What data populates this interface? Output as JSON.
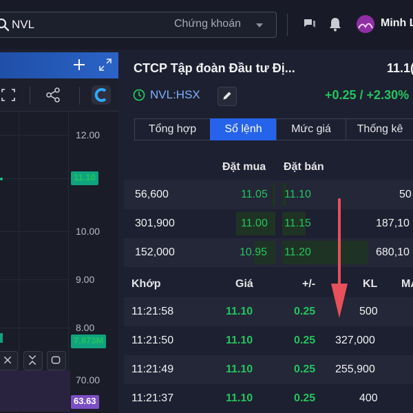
{
  "search": {
    "value": "NVL",
    "market": "Chứng khoán"
  },
  "user": {
    "name": "Minh L"
  },
  "chart": {
    "axis_labels": [
      "12.00",
      "10.00",
      "9.00",
      "8.00",
      "70.00"
    ],
    "price_tags": [
      "11.10",
      "7.873M",
      "63.63"
    ]
  },
  "stock": {
    "company": "CTCP Tập đoàn Đầu tư Đị...",
    "price": "11.1(",
    "ticker": "NVL:HSX",
    "change": "+0.25 / +2.30%",
    "tabs": [
      "Tổng hợp",
      "Sổ lệnh",
      "Mức giá",
      "Thống kê"
    ]
  },
  "order_book": {
    "headers": {
      "bid": "Đặt mua",
      "ask": "Đặt bán"
    },
    "rows": [
      {
        "bid_vol": "56,600",
        "bid_price": "11.05",
        "ask_price": "11.10",
        "ask_vol": "50"
      },
      {
        "bid_vol": "301,900",
        "bid_price": "11.00",
        "ask_price": "11.15",
        "ask_vol": "187,10"
      },
      {
        "bid_vol": "152,000",
        "bid_price": "10.95",
        "ask_price": "11.20",
        "ask_vol": "680,10"
      }
    ]
  },
  "matches": {
    "headers": {
      "time": "Khớp",
      "price": "Giá",
      "change": "+/-",
      "volume": "KL",
      "type": "MA"
    },
    "rows": [
      {
        "time": "11:21:58",
        "price": "11.10",
        "change": "0.25",
        "volume": "500"
      },
      {
        "time": "11:21:50",
        "price": "11.10",
        "change": "0.25",
        "volume": "327,000"
      },
      {
        "time": "11:21:49",
        "price": "11.10",
        "change": "0.25",
        "volume": "255,900"
      },
      {
        "time": "11:21:37",
        "price": "11.10",
        "change": "0.25",
        "volume": "400"
      }
    ]
  },
  "colors": {
    "accent": "#2563eb",
    "up": "#22c55e",
    "annotation": "#e8505b"
  }
}
